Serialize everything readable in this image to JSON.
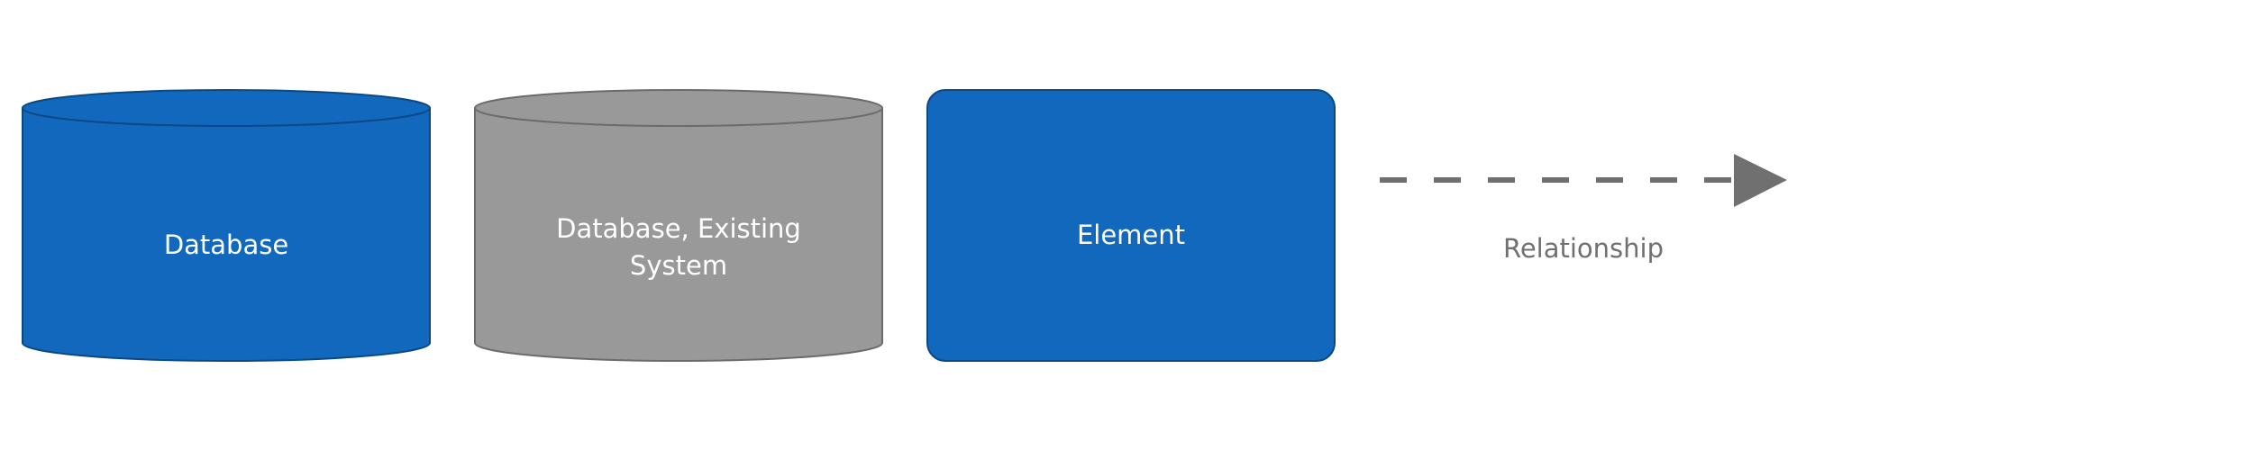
{
  "legend": {
    "items": [
      {
        "kind": "database",
        "label_lines": [
          "Database"
        ],
        "fill": "#1168BD",
        "stroke": "#0B4884"
      },
      {
        "kind": "database",
        "label_lines": [
          "Database, Existing",
          "System"
        ],
        "fill": "#999999",
        "stroke": "#6B6B6B"
      },
      {
        "kind": "element",
        "label_lines": [
          "Element"
        ],
        "fill": "#1168BD",
        "stroke": "#0B4884"
      }
    ],
    "relationship": {
      "label": "Relationship",
      "line_color": "#707070",
      "style": "dashed",
      "arrow": "filled-triangle"
    }
  }
}
